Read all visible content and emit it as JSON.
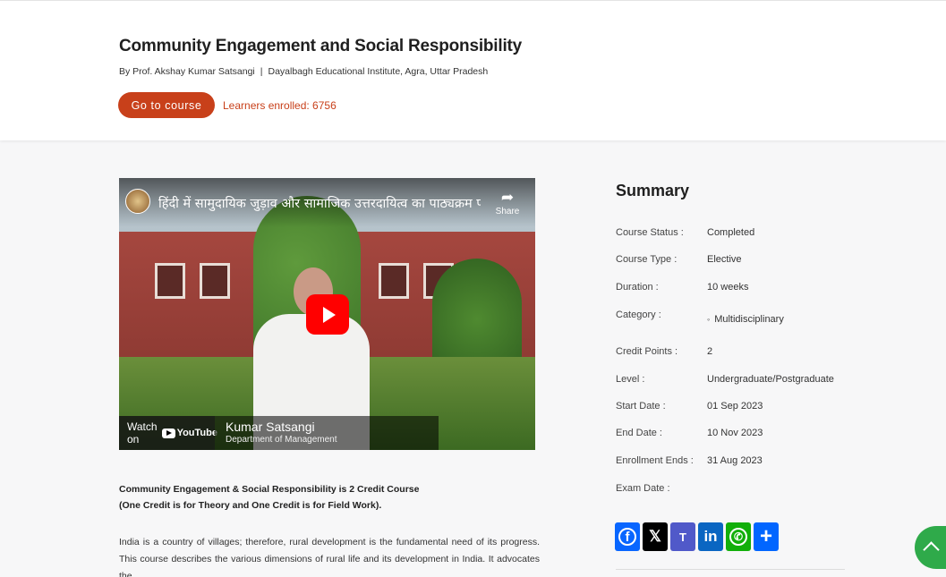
{
  "course": {
    "title": "Community Engagement and Social Responsibility",
    "instructor": "By Prof. Akshay Kumar Satsangi",
    "separator": "|",
    "institute": "Dayalbagh Educational Institute, Agra, Uttar Pradesh",
    "go_button": "Go to course",
    "enrolled": "Learners enrolled: 6756"
  },
  "video": {
    "title": "हिंदी में सामुदायिक जुड़ाव और सामाजिक उत्तरदायित्व का पाठ्यक्रम परिच...",
    "share_label": "Share",
    "watch_on": "Watch on",
    "youtube": "YouTube",
    "lower_third_name": "Kumar Satsangi",
    "lower_third_dept": "Department of Management"
  },
  "description": {
    "line1": "Community Engagement & Social Responsibility is 2 Credit Course",
    "line2": "(One Credit is for Theory and One Credit is for Field Work).",
    "para": "India is a country of villages; therefore, rural development is the fundamental need of its progress. This course describes the various dimensions of rural life and its development in India.  It advocates the"
  },
  "summary": {
    "title": "Summary",
    "rows": [
      {
        "label": "Course Status :",
        "value": "Completed"
      },
      {
        "label": "Course Type :",
        "value": "Elective"
      },
      {
        "label": "Duration :",
        "value": "10 weeks"
      },
      {
        "label": "Category :",
        "value": "Multidisciplinary"
      },
      {
        "label": "Credit Points :",
        "value": "2"
      },
      {
        "label": "Level :",
        "value": "Undergraduate/Postgraduate"
      },
      {
        "label": "Start Date :",
        "value": "01 Sep 2023"
      },
      {
        "label": "End Date :",
        "value": "10 Nov 2023"
      },
      {
        "label": "Enrollment Ends :",
        "value": "31 Aug 2023"
      },
      {
        "label": "Exam Date :",
        "value": ""
      }
    ]
  },
  "share_icons": [
    "facebook-icon",
    "x-icon",
    "teams-icon",
    "linkedin-icon",
    "whatsapp-icon",
    "share-more-icon"
  ],
  "colors": {
    "accent": "#c8401a",
    "scroll_top": "#2faa4a",
    "youtube_red": "#ff0000"
  }
}
